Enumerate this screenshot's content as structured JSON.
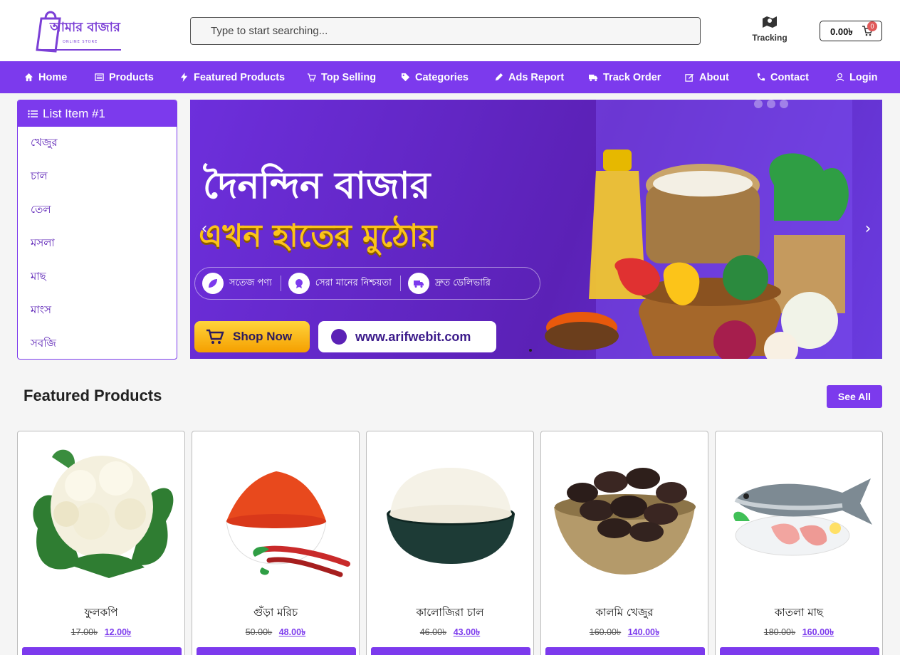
{
  "header": {
    "logo_text": "আমার বাজার",
    "logo_sub": "ONLINE STORE",
    "search_placeholder": "Type to start searching...",
    "tracking_label": "Tracking",
    "cart_amount": "0.00৳",
    "cart_count": "0"
  },
  "nav": [
    {
      "label": "Home",
      "icon": "home-icon"
    },
    {
      "label": "Products",
      "icon": "list-icon"
    },
    {
      "label": "Featured Products",
      "icon": "bolt-icon"
    },
    {
      "label": "Top Selling",
      "icon": "cart-icon"
    },
    {
      "label": "Categories",
      "icon": "tag-icon"
    },
    {
      "label": "Ads Report",
      "icon": "pen-icon"
    },
    {
      "label": "Track Order",
      "icon": "truck-icon"
    },
    {
      "label": "About",
      "icon": "edit-icon"
    },
    {
      "label": "Contact",
      "icon": "phone-icon"
    },
    {
      "label": "Login",
      "icon": "user-icon"
    }
  ],
  "sidebar": {
    "title": "List Item #1",
    "items": [
      "খেজুর",
      "চাল",
      "তেল",
      "মসলা",
      "মাছ",
      "মাংস",
      "সবজি"
    ]
  },
  "banner": {
    "line1": "দৈনন্দিন বাজার",
    "line2": "এখন হাতের মুঠোয়",
    "features": [
      "সতেজ পণ্য",
      "সেরা মানের নিশ্চয়তা",
      "দ্রুত ডেলিভারি"
    ],
    "shop_now": "Shop Now",
    "url": "www.arifwebit.com"
  },
  "featured": {
    "title": "Featured Products",
    "see_all": "See All",
    "products": [
      {
        "name": "ফুলকপি",
        "old_price": "17.00৳",
        "new_price": "12.00৳"
      },
      {
        "name": "গুঁড়া মরিচ",
        "old_price": "50.00৳",
        "new_price": "48.00৳"
      },
      {
        "name": "কালোজিরা চাল",
        "old_price": "46.00৳",
        "new_price": "43.00৳"
      },
      {
        "name": "কালমি খেজুর",
        "old_price": "160.00৳",
        "new_price": "140.00৳"
      },
      {
        "name": "কাতলা মাছ",
        "old_price": "180.00৳",
        "new_price": "160.00৳"
      }
    ]
  },
  "colors": {
    "brand": "#7c3aed",
    "accent_yellow": "#fcc419"
  }
}
